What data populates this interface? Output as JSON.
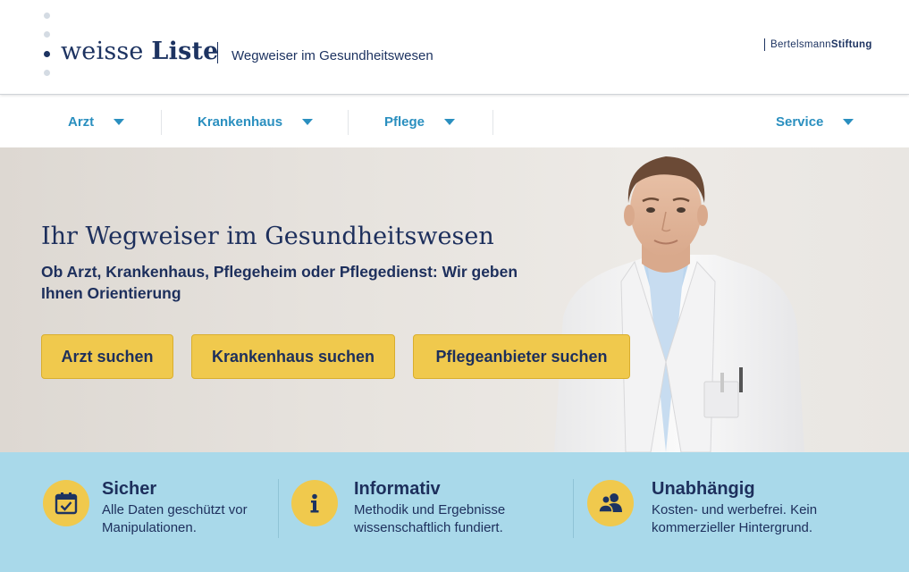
{
  "header": {
    "logo_word1": "weisse",
    "logo_word2": "Liste",
    "tagline": "Wegweiser im Gesundheitswesen",
    "partner_part1": "Bertelsmann",
    "partner_part2": "Stiftung"
  },
  "nav": {
    "items": [
      {
        "label": "Arzt"
      },
      {
        "label": "Krankenhaus"
      },
      {
        "label": "Pflege"
      },
      {
        "label": "Service"
      }
    ]
  },
  "hero": {
    "title": "Ihr Wegweiser im Gesundheitswesen",
    "subtitle": "Ob Arzt, Krankenhaus, Pflegeheim oder Pflegedienst: Wir geben Ihnen Orientierung",
    "buttons": [
      {
        "label": "Arzt suchen"
      },
      {
        "label": "Krankenhaus suchen"
      },
      {
        "label": "Pflegeanbieter suchen"
      }
    ]
  },
  "features": [
    {
      "icon": "calendar-check-icon",
      "title": "Sicher",
      "text": "Alle Daten geschützt vor Manipulationen."
    },
    {
      "icon": "info-icon",
      "title": "Informativ",
      "text": "Methodik und Ergebnisse wissenschaftlich fundiert."
    },
    {
      "icon": "users-icon",
      "title": "Unabhängig",
      "text": "Kosten- und werbefrei. Kein kommerzieller Hintergrund."
    }
  ],
  "colors": {
    "brand_navy": "#1d3361",
    "nav_blue": "#2a8fbf",
    "cta_yellow": "#f0c94d",
    "feature_bg": "#a9d9ea"
  }
}
